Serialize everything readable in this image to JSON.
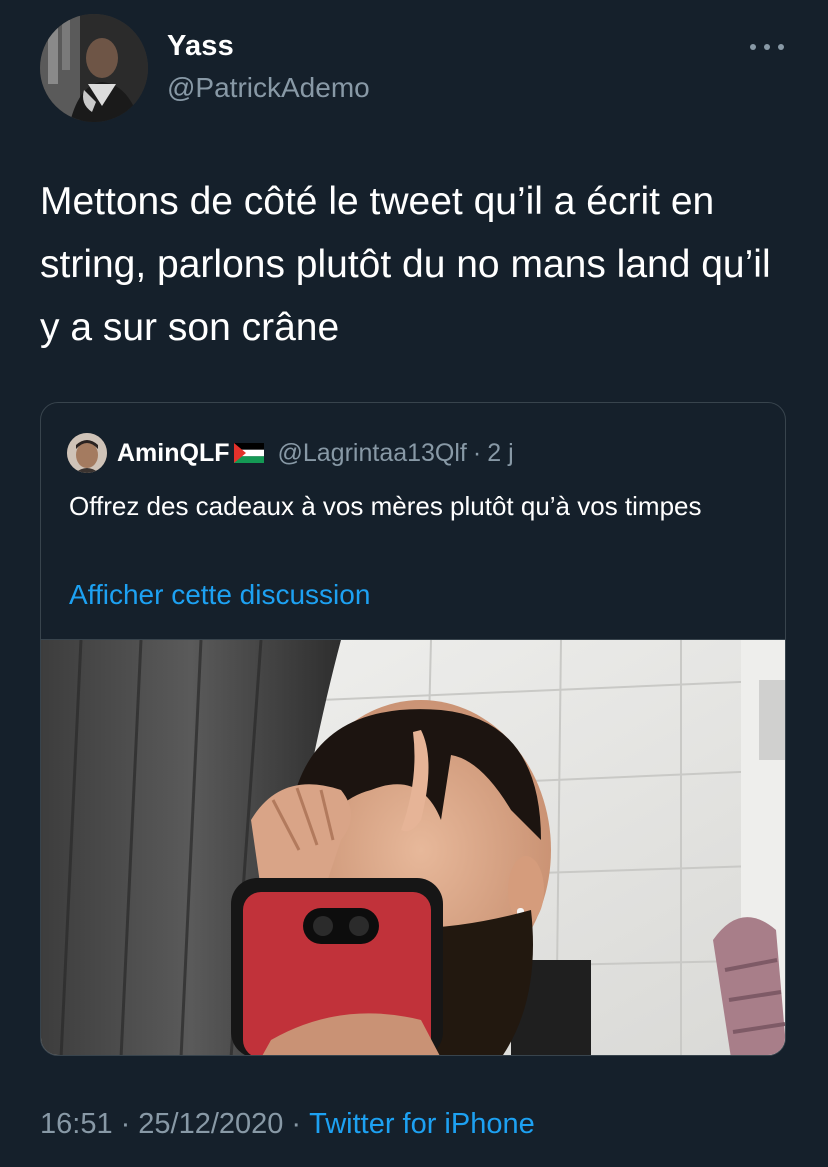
{
  "author": {
    "display_name": "Yass",
    "handle": "@PatrickAdemo",
    "avatar_icon": "user-avatar"
  },
  "more_icon": "more-options-icon",
  "tweet": {
    "text": "Mettons de côté le tweet qu’il a écrit en string, parlons plutôt du no mans land qu’il y a sur son crâne"
  },
  "quoted_tweet": {
    "display_name": "AminQLF",
    "flag_icon": "palestine-flag-icon",
    "handle": "@Lagrintaa13Qlf",
    "separator": "·",
    "time": "2 j",
    "text": "Offrez des cadeaux à vos mères plutôt qu’à vos timpes",
    "show_thread_label": "Afficher cette discussion",
    "media_icon": "selfie-photo"
  },
  "footer": {
    "time": "16:51",
    "separator": "·",
    "date": "25/12/2020",
    "separator2": "·",
    "source": "Twitter for iPhone"
  },
  "colors": {
    "background": "#15202b",
    "text_primary": "#ffffff",
    "text_secondary": "#8899a6",
    "link": "#1da1f2",
    "border": "#38444d"
  }
}
